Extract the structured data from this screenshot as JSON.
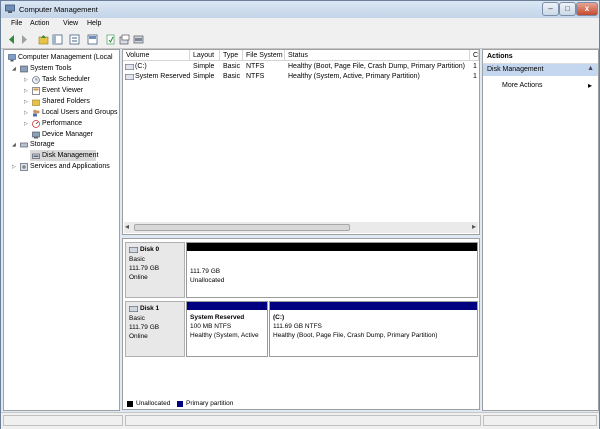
{
  "window": {
    "title": "Computer Management",
    "min_glyph": "–",
    "max_glyph": "□",
    "close_glyph": "x"
  },
  "menu": [
    {
      "label": "File"
    },
    {
      "label": "Action"
    },
    {
      "label": "View"
    },
    {
      "label": "Help"
    }
  ],
  "toolbar": [
    "back-icon",
    "forward-icon",
    "up-folder-icon",
    "show-hide-tree-icon",
    "properties-icon",
    "help-icon",
    "refresh-icon",
    "export-icon",
    "disk-icon",
    "settings-icon"
  ],
  "tree": {
    "root": "Computer Management (Local",
    "system_tools": "System Tools",
    "task_scheduler": "Task Scheduler",
    "event_viewer": "Event Viewer",
    "shared_folders": "Shared Folders",
    "local_users": "Local Users and Groups",
    "performance": "Performance",
    "device_manager": "Device Manager",
    "storage": "Storage",
    "disk_management": "Disk Management",
    "services": "Services and Applications"
  },
  "volumes": {
    "columns": [
      "Volume",
      "Layout",
      "Type",
      "File System",
      "Status",
      "C"
    ],
    "rows": [
      {
        "volume": "(C:)",
        "layout": "Simple",
        "type": "Basic",
        "fs": "NTFS",
        "status": "Healthy (Boot, Page File, Crash Dump, Primary Partition)",
        "c": "1"
      },
      {
        "volume": "System Reserved",
        "layout": "Simple",
        "type": "Basic",
        "fs": "NTFS",
        "status": "Healthy (System, Active, Primary Partition)",
        "c": "1"
      }
    ],
    "scroll_left": "◂",
    "scroll_right": "▸"
  },
  "disks": [
    {
      "name": "Disk 0",
      "type": "Basic",
      "size": "111.79 GB",
      "state": "Online",
      "partitions": [
        {
          "size": "111.79 GB",
          "status": "Unallocated"
        }
      ]
    },
    {
      "name": "Disk 1",
      "type": "Basic",
      "size": "111.79 GB",
      "state": "Online",
      "partitions": [
        {
          "name": "System Reserved",
          "size": "100 MB NTFS",
          "status": "Healthy (System, Active"
        },
        {
          "name": "(C:)",
          "size": "111.69 GB NTFS",
          "status": "Healthy (Boot, Page File, Crash Dump, Primary Partition)"
        }
      ]
    }
  ],
  "legend": {
    "unallocated": "Unallocated",
    "primary": "Primary partition"
  },
  "actions": {
    "header": "Actions",
    "section": "Disk Management",
    "more": "More Actions",
    "collapse_glyph": "▲",
    "more_glyph": "▸"
  },
  "colors": {
    "unallocated": "#000000",
    "primary": "#000080",
    "action_section": "#c5d7ee"
  }
}
